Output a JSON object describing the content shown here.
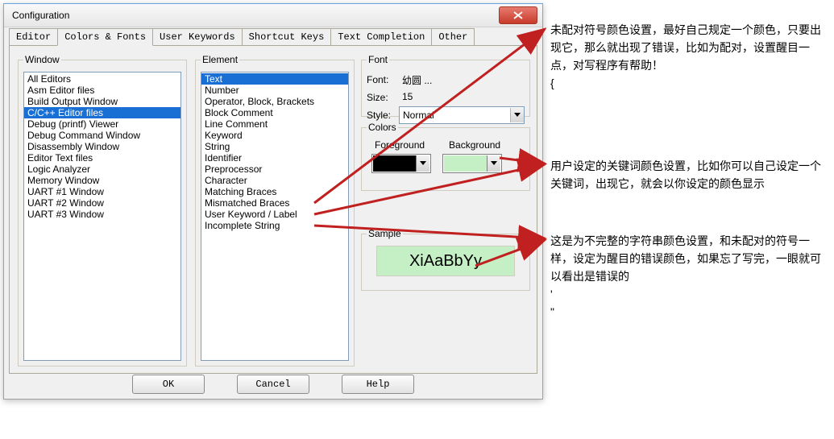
{
  "title": "Configuration",
  "tabs": [
    "Editor",
    "Colors & Fonts",
    "User Keywords",
    "Shortcut Keys",
    "Text Completion",
    "Other"
  ],
  "active_tab": 1,
  "groupbox": {
    "window": "Window",
    "element": "Element",
    "font": "Font",
    "colors": "Colors",
    "sample": "Sample"
  },
  "window_items": [
    "All Editors",
    "Asm Editor files",
    "Build Output Window",
    "C/C++ Editor files",
    "Debug (printf) Viewer",
    "Debug Command Window",
    "Disassembly Window",
    "Editor Text files",
    "Logic Analyzer",
    "Memory Window",
    "UART #1 Window",
    "UART #2 Window",
    "UART #3 Window"
  ],
  "window_selected": 3,
  "element_items": [
    "Text",
    "Number",
    "Operator, Block, Brackets",
    "Block Comment",
    "Line Comment",
    "Keyword",
    "String",
    "Identifier",
    "Preprocessor",
    "Character",
    "Matching Braces",
    "Mismatched Braces",
    "User Keyword / Label",
    "Incomplete String"
  ],
  "element_selected": 0,
  "font": {
    "font_label": "Font:",
    "font_value": "幼圆 ...",
    "size_label": "Size:",
    "size_value": "15",
    "style_label": "Style:",
    "style_value": "Normal"
  },
  "colors": {
    "fg_label": "Foreground",
    "bg_label": "Background",
    "fg_value": "#000000",
    "bg_value": "#c5f0c5"
  },
  "sample_text": "XiAaBbYy",
  "buttons": {
    "ok": "OK",
    "cancel": "Cancel",
    "help": "Help"
  },
  "annotations": {
    "a1": "未配对符号颜色设置，最好自己规定一个颜色，只要出现它，那么就出现了错误，比如为配对，设置醒目一点，对写程序有帮助！",
    "a1_brace": "{",
    "a2": "用户设定的关键词颜色设置，比如你可以自己设定一个关键词，出现它，就会以你设定的颜色显示",
    "a3": "这是为不完整的字符串颜色设置，和未配对的符号一样，设定为醒目的错误颜色，如果忘了写完，一眼就可以看出是错误的",
    "a3_q1": "'",
    "a3_q2": "\""
  }
}
